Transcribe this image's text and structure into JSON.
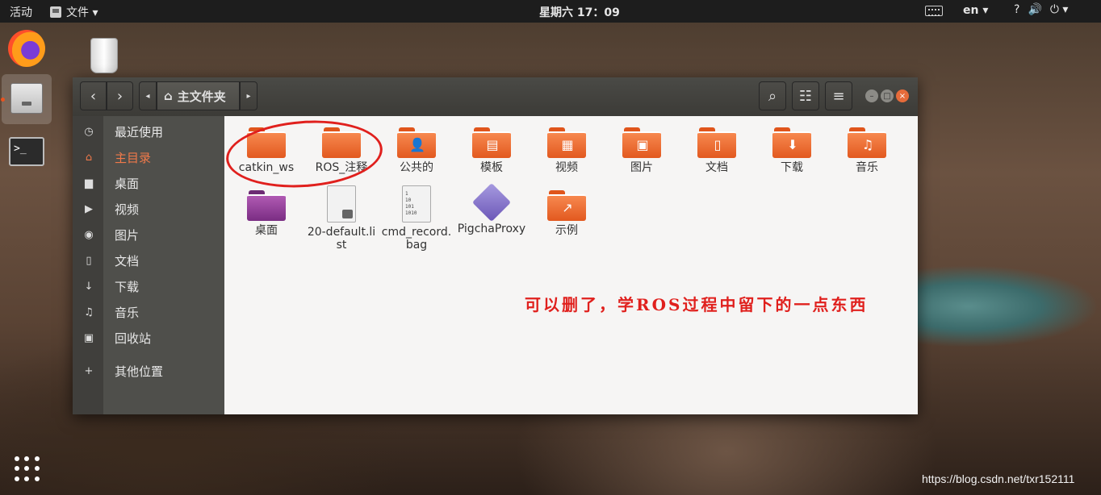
{
  "topbar": {
    "activities": "活动",
    "app_menu": "文件 ▾",
    "clock": "星期六 17：09",
    "language": "en ▾",
    "tray": [
      "?",
      "🔊",
      "⏻ ▾"
    ]
  },
  "dock": {
    "terminal_prompt": ">_"
  },
  "window": {
    "path": "主文件夹",
    "sidebar": [
      {
        "label": "最近使用",
        "icon": "clock-icon",
        "glyph": "◷"
      },
      {
        "label": "主目录",
        "icon": "home-icon",
        "glyph": "⌂"
      },
      {
        "label": "桌面",
        "icon": "folder-icon",
        "glyph": "▆"
      },
      {
        "label": "视频",
        "icon": "video-icon",
        "glyph": "▶"
      },
      {
        "label": "图片",
        "icon": "camera-icon",
        "glyph": "◉"
      },
      {
        "label": "文档",
        "icon": "document-icon",
        "glyph": "▯"
      },
      {
        "label": "下载",
        "icon": "download-icon",
        "glyph": "↓"
      },
      {
        "label": "音乐",
        "icon": "music-icon",
        "glyph": "♫"
      },
      {
        "label": "回收站",
        "icon": "trash-icon",
        "glyph": "▣"
      },
      {
        "label": "其他位置",
        "icon": "plus-icon",
        "glyph": "+"
      }
    ],
    "files": [
      {
        "label": "catkin_ws",
        "kind": "folder",
        "emblem": ""
      },
      {
        "label": "ROS_注释",
        "kind": "folder",
        "emblem": ""
      },
      {
        "label": "公共的",
        "kind": "folder",
        "emblem": "👤"
      },
      {
        "label": "模板",
        "kind": "folder",
        "emblem": "▤"
      },
      {
        "label": "视频",
        "kind": "folder",
        "emblem": "▦"
      },
      {
        "label": "图片",
        "kind": "folder",
        "emblem": "▣"
      },
      {
        "label": "文档",
        "kind": "folder",
        "emblem": "▯"
      },
      {
        "label": "下载",
        "kind": "folder",
        "emblem": "⬇"
      },
      {
        "label": "音乐",
        "kind": "folder",
        "emblem": "♫"
      },
      {
        "label": "桌面",
        "kind": "folder-purple",
        "emblem": ""
      },
      {
        "label": "20-default.list",
        "kind": "doc-locked",
        "emblem": ""
      },
      {
        "label": "cmd_record.bag",
        "kind": "binary",
        "emblem": "1\n10\n101\n1010"
      },
      {
        "label": "PigchaProxy",
        "kind": "diamond",
        "emblem": ""
      },
      {
        "label": "示例",
        "kind": "folder",
        "emblem": "↗"
      }
    ],
    "annotation": "可以删了，学ROS过程中留下的一点东西"
  },
  "watermark": "https://blog.csdn.net/txr152111",
  "colors": {
    "accent": "#e95420",
    "annotation": "#e0201d"
  }
}
